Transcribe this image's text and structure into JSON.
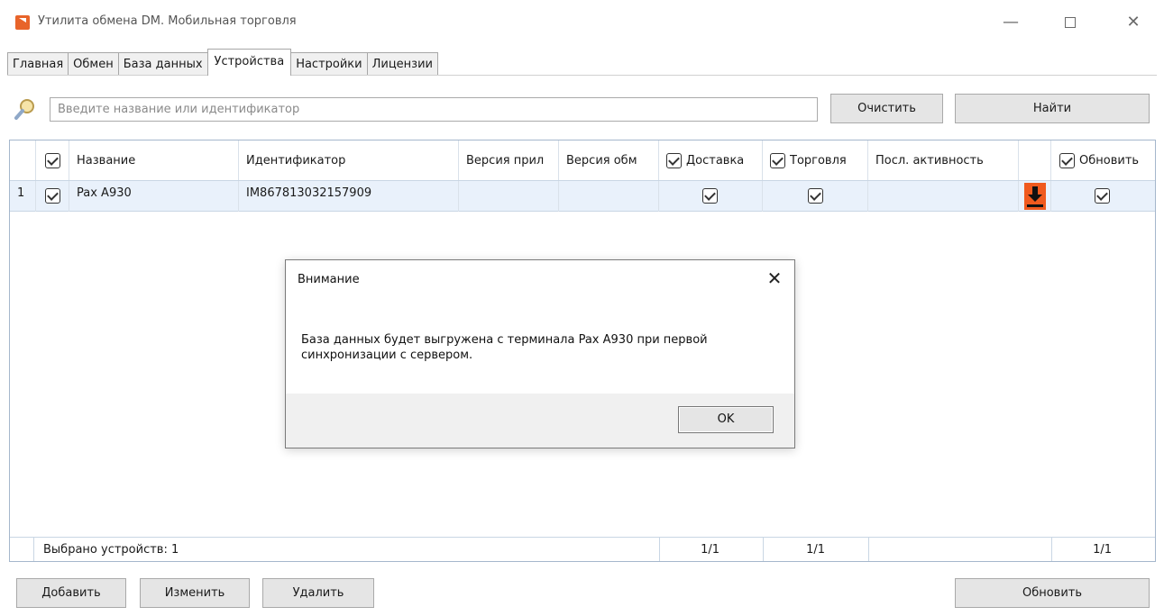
{
  "window": {
    "title": "Утилита обмена DM. Мобильная торговля",
    "controls": {
      "minimize": "—",
      "close": "✕"
    }
  },
  "tabs": [
    {
      "label": "Главная"
    },
    {
      "label": "Обмен"
    },
    {
      "label": "База данных"
    },
    {
      "label": "Устройства",
      "active": true
    },
    {
      "label": "Настройки"
    },
    {
      "label": "Лицензии"
    }
  ],
  "search": {
    "placeholder": "Введите название или идентификатор",
    "clear_label": "Очистить",
    "find_label": "Найти",
    "icon": "search-icon"
  },
  "grid": {
    "headers": {
      "name": "Название",
      "id": "Идентификатор",
      "app_version": "Версия прил",
      "exchange_version": "Версия обм",
      "delivery": "Доставка",
      "trade": "Торговля",
      "last_activity": "Посл. активность",
      "update": "Обновить"
    },
    "rows": [
      {
        "index": "1",
        "name": "Pax A930",
        "id": "IM867813032157909",
        "app_version": "",
        "exchange_version": "",
        "last_activity": ""
      }
    ],
    "footer": {
      "selected": "Выбрано устройств: 1",
      "delivery_count": "1/1",
      "trade_count": "1/1",
      "update_count": "1/1"
    }
  },
  "actions": {
    "add_label": "Добавить",
    "edit_label": "Изменить",
    "delete_label": "Удалить",
    "refresh_label": "Обновить"
  },
  "dialog": {
    "title": "Внимание",
    "message": "База данных будет выгружена с терминала Pax A930 при первой синхронизации с сервером.",
    "ok_label": "OK",
    "close": "✕"
  },
  "colors": {
    "accent": "#e8642a",
    "row_selected": "#e9f1fb",
    "grid_border": "#a5b7cc",
    "download_icon": "#f05a1e"
  }
}
